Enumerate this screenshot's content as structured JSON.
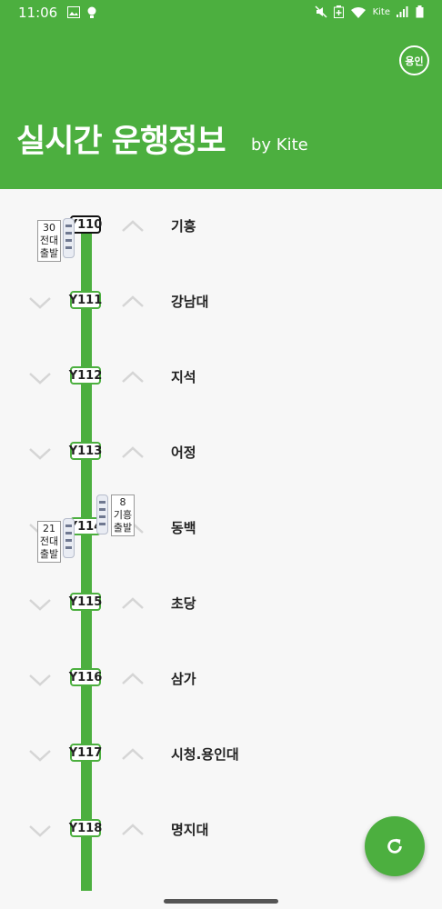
{
  "status_bar": {
    "time": "11:06",
    "carrier": "Kite"
  },
  "header": {
    "title": "실시간 운행정보",
    "subtitle": "by Kite",
    "city_badge": "용인"
  },
  "stations": [
    {
      "code": "Y110",
      "name": "기흥"
    },
    {
      "code": "Y111",
      "name": "강남대"
    },
    {
      "code": "Y112",
      "name": "지석"
    },
    {
      "code": "Y113",
      "name": "어정"
    },
    {
      "code": "Y114",
      "name": "동백"
    },
    {
      "code": "Y115",
      "name": "초당"
    },
    {
      "code": "Y116",
      "name": "삼가"
    },
    {
      "code": "Y117",
      "name": "시청.용인대"
    },
    {
      "code": "Y118",
      "name": "명지대"
    }
  ],
  "trains": [
    {
      "number": "30",
      "origin": "전대",
      "status": "출발"
    },
    {
      "number": "21",
      "origin": "전대",
      "status": "출발"
    },
    {
      "number": "8",
      "origin": "기흥",
      "status": "출발"
    }
  ]
}
